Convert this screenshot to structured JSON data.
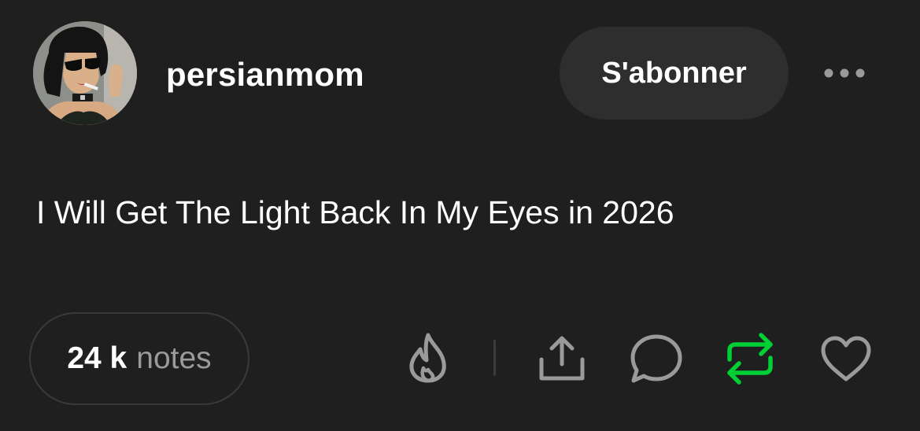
{
  "post": {
    "username": "persianmom",
    "follow_label": "S'abonner",
    "text": "I Will Get The Light Back In My Eyes in 2026",
    "notes_count": "24 k",
    "notes_label": "notes"
  },
  "icons": {
    "more": "more-horizontal-icon",
    "blaze": "flame-icon",
    "share": "share-upload-icon",
    "reply": "speech-bubble-icon",
    "reblog": "reblog-arrows-icon",
    "like": "heart-icon"
  },
  "colors": {
    "background": "#1f1f1f",
    "follow_button_bg": "#2e2e2e",
    "icon_gray": "#9a9a9a",
    "reblog_green": "#00cf35"
  }
}
